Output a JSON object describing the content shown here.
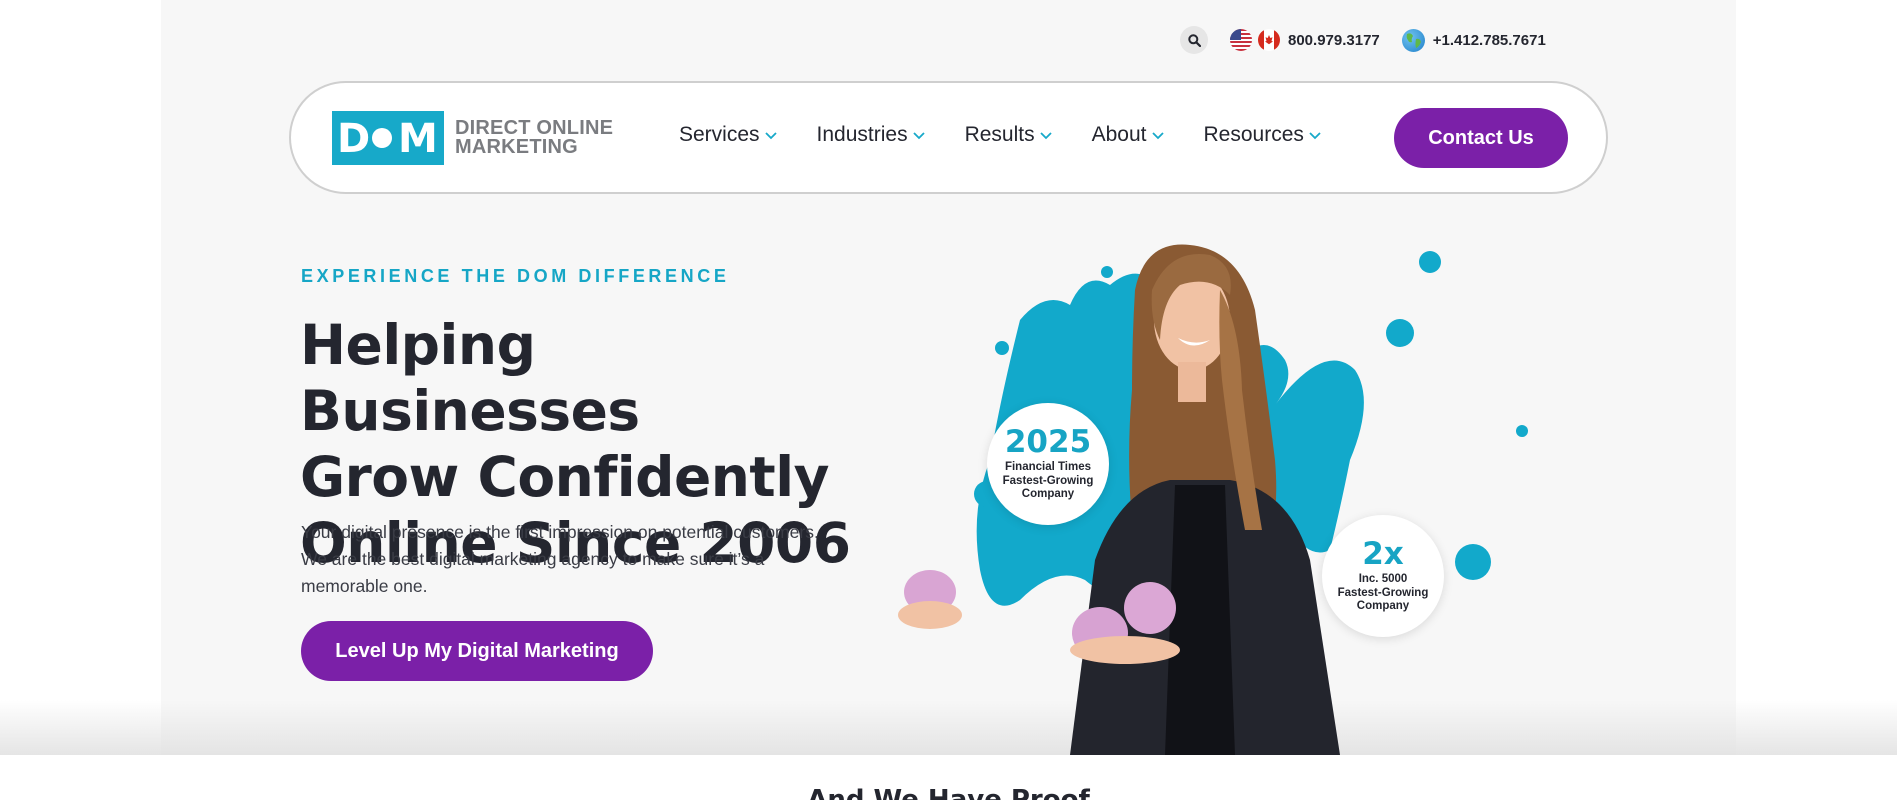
{
  "header": {
    "search_icon": "search-icon",
    "phone_us_ca": "800.979.3177",
    "phone_intl": "+1.412.785.7671"
  },
  "nav": {
    "logo_mark": "D●M",
    "logo_line1": "DIRECT ONLINE",
    "logo_line2": "MARKETING",
    "items": [
      {
        "label": "Services"
      },
      {
        "label": "Industries"
      },
      {
        "label": "Results"
      },
      {
        "label": "About"
      },
      {
        "label": "Resources"
      }
    ],
    "contact_label": "Contact Us"
  },
  "hero": {
    "eyebrow": "EXPERIENCE THE DOM DIFFERENCE",
    "headline_line1": "Helping Businesses",
    "headline_line2": "Grow Confidently",
    "headline_line3": "Online Since 2006",
    "description": "Your digital presence is the first impression on potential customers. We are the best digital marketing agency to make sure it’s a memorable one.",
    "cta_label": "Level Up My Digital Marketing",
    "badge1_big": "2025",
    "badge1_line1": "Financial Times",
    "badge1_line2": "Fastest-Growing",
    "badge1_line3": "Company",
    "badge2_big": "2x",
    "badge2_line1": "Inc. 5000",
    "badge2_line2": "Fastest-Growing",
    "badge2_line3": "Company"
  },
  "next_section": {
    "title": "And We Have Proof"
  },
  "colors": {
    "accent": "#17a9c9",
    "brand_purple": "#7b20a8",
    "text_dark": "#24262f"
  }
}
